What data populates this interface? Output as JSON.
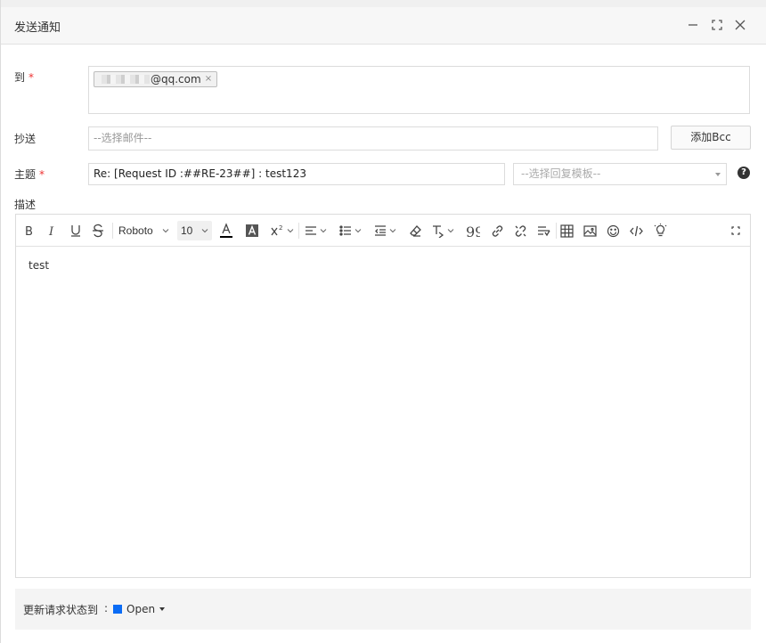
{
  "dialog": {
    "title": "发送通知",
    "minimize_icon": "minimize-icon",
    "maximize_icon": "maximize-icon",
    "close_icon": "close-icon"
  },
  "form": {
    "to_label": "到",
    "required_mark": "*",
    "to_recipient": "@qq.com",
    "chip_remove": "×",
    "cc_label": "抄送",
    "cc_placeholder": "--选择邮件--",
    "add_bcc": "添加Bcc",
    "subject_label": "主题",
    "subject_value": "Re: [Request ID :##RE-23##] : test123",
    "template_placeholder": "--选择回复模板--",
    "help": "?",
    "description_label": "描述"
  },
  "editor": {
    "font_family": "Roboto",
    "font_size": "10",
    "content": "test",
    "tools": [
      "bold-icon",
      "italic-icon",
      "underline-icon",
      "strikethrough-icon",
      "font-color-icon",
      "highlight-icon",
      "superscript-icon",
      "align-icon",
      "list-icon",
      "indent-icon",
      "eraser-icon",
      "clear-format-icon",
      "quote-icon",
      "link-icon",
      "unlink-icon",
      "line-spacing-icon",
      "table-icon",
      "image-icon",
      "emoji-icon",
      "code-icon",
      "tip-icon",
      "fullscreen-icon"
    ]
  },
  "footer": {
    "label": "更新请求状态到",
    "colon": ":",
    "status": "Open",
    "status_color": "#0a6cf5"
  }
}
